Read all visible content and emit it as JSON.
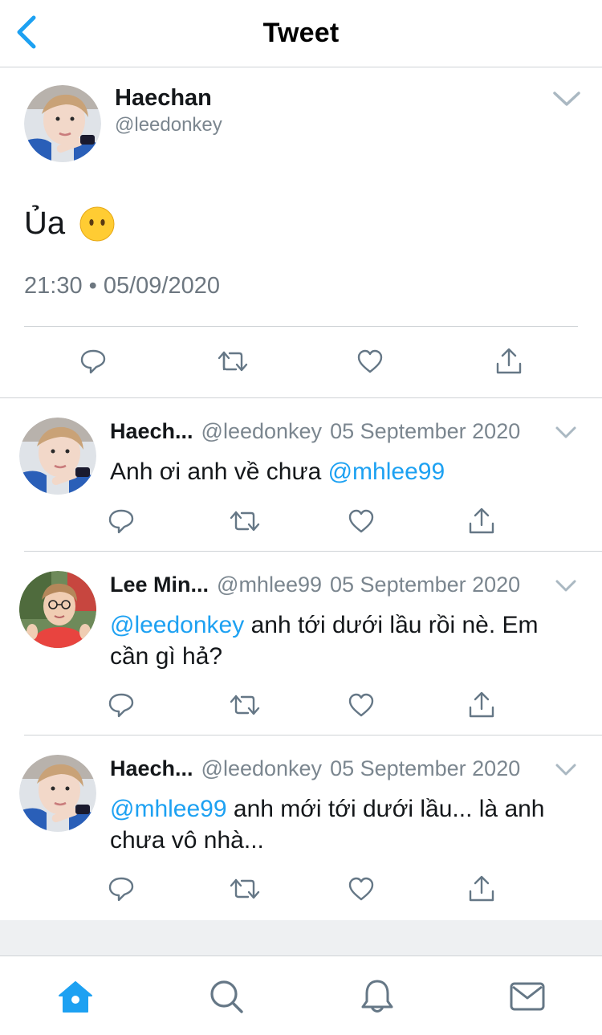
{
  "header": {
    "title": "Tweet"
  },
  "main_tweet": {
    "author_name": "Haechan",
    "handle": "@leedonkey",
    "text": "Ủa",
    "emoji": "neutral-face-emoji",
    "timestamp": "21:30 • 05/09/2020"
  },
  "replies": [
    {
      "author_name": "Haech...",
      "handle": "@leedonkey",
      "date": "05 September 2020",
      "text_before": "Anh ơi anh về chưa ",
      "mention": "@mhlee99",
      "text_after": "",
      "avatar": "haechan-avatar"
    },
    {
      "author_name": "Lee Min...",
      "handle": "@mhlee99",
      "date": "05 September 2020",
      "text_before": "",
      "mention": "@leedonkey",
      "text_after": " anh tới dưới lầu rồi nè. Em cần gì hả?",
      "avatar": "minhyung-avatar"
    },
    {
      "author_name": "Haech...",
      "handle": "@leedonkey",
      "date": "05 September 2020",
      "text_before": "",
      "mention": "@mhlee99",
      "text_after": " anh mới tới dưới lầu... là anh chưa vô nhà...",
      "avatar": "haechan-avatar"
    }
  ],
  "tabs": [
    "home-icon",
    "search-icon",
    "notifications-icon",
    "messages-icon"
  ],
  "colors": {
    "accent": "#1da1f2",
    "secondary_text": "#7b868f",
    "icon_gray": "#657786",
    "divider": "#cfd3d6",
    "band": "#eef0f2"
  }
}
